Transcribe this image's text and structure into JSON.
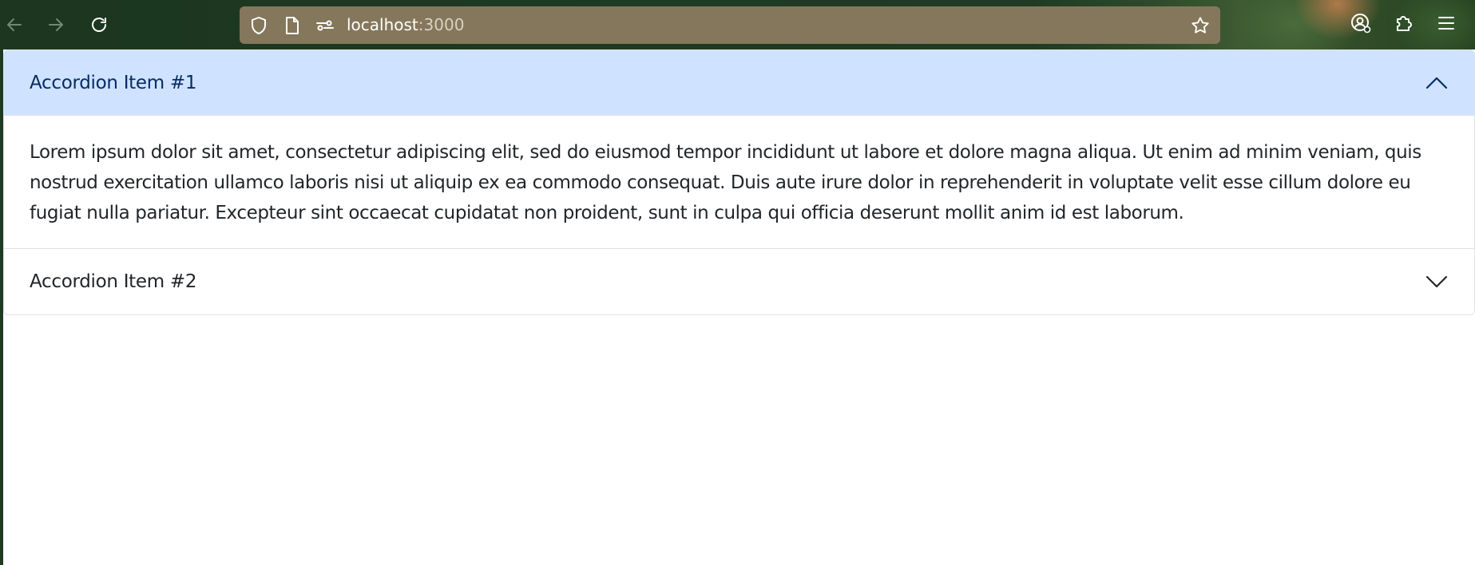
{
  "browser": {
    "url_host": "localhost",
    "url_port": ":3000",
    "icons": {
      "back": "arrow-left-icon",
      "forward": "arrow-right-icon",
      "reload": "reload-icon",
      "tracking": "shield-icon",
      "page_info": "document-icon",
      "permissions": "permissions-icon",
      "bookmark": "star-icon",
      "account": "account-icon",
      "extensions": "puzzle-icon",
      "menu": "hamburger-menu-icon"
    }
  },
  "accordion": {
    "items": [
      {
        "title": "Accordion Item #1",
        "expanded": true,
        "body": "Lorem ipsum dolor sit amet, consectetur adipiscing elit, sed do eiusmod tempor incididunt ut labore et dolore magna aliqua. Ut enim ad minim veniam, quis nostrud exercitation ullamco laboris nisi ut aliquip ex ea commodo consequat. Duis aute irure dolor in reprehenderit in voluptate velit esse cillum dolore eu fugiat nulla pariatur. Excepteur sint occaecat cupidatat non proident, sunt in culpa qui officia deserunt mollit anim id est laborum."
      },
      {
        "title": "Accordion Item #2",
        "expanded": false
      }
    ]
  },
  "colors": {
    "toolbar_bg": "#1e3a22",
    "urlbar_bg": "#85775b",
    "header_active_bg": "#cfe2ff",
    "header_active_text": "#052c65",
    "text": "#212529",
    "border": "#dee2e6"
  }
}
